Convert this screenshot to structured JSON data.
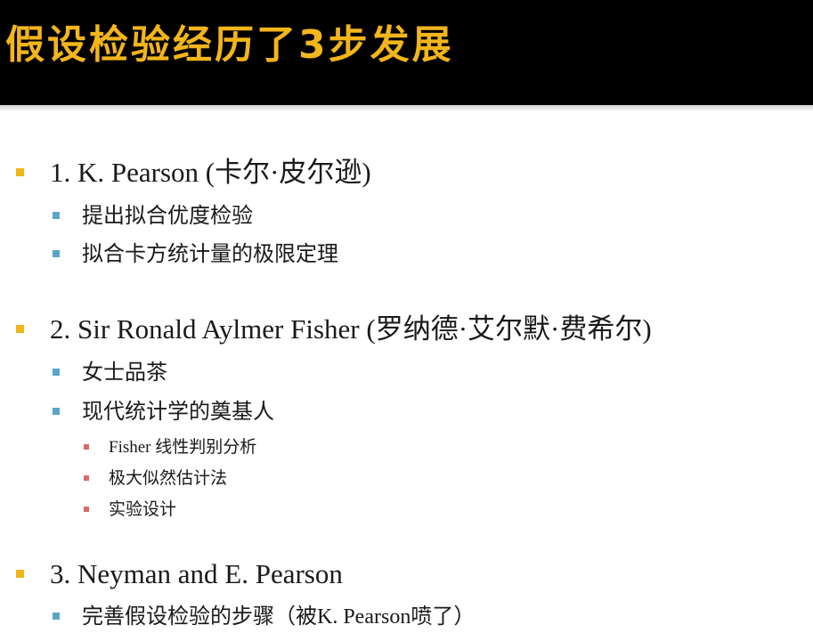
{
  "slide": {
    "title": "假设检验经历了3步发展",
    "colors": {
      "title": "#f2b51a",
      "title_bar": "#000000"
    }
  },
  "outline": [
    {
      "level": 1,
      "bullet_color": "#f2b51a",
      "text": "1. K. Pearson (卡尔·皮尔逊)",
      "children": [
        {
          "level": 2,
          "bullet_color": "#5aa6c8",
          "text": "提出拟合优度检验"
        },
        {
          "level": 2,
          "bullet_color": "#5aa6c8",
          "text": "拟合卡方统计量的极限定理"
        }
      ]
    },
    {
      "level": 1,
      "bullet_color": "#f2b51a",
      "text": "2. Sir Ronald Aylmer Fisher (罗纳德·艾尔默·费希尔)",
      "children": [
        {
          "level": 2,
          "bullet_color": "#5aa6c8",
          "text": "女士品茶"
        },
        {
          "level": 2,
          "bullet_color": "#5aa6c8",
          "text": "现代统计学的奠基人",
          "children": [
            {
              "level": 3,
              "bullet_color": "#d96a6a",
              "text": "Fisher 线性判别分析"
            },
            {
              "level": 3,
              "bullet_color": "#d96a6a",
              "text": "极大似然估计法"
            },
            {
              "level": 3,
              "bullet_color": "#d96a6a",
              "text": "实验设计"
            }
          ]
        }
      ]
    },
    {
      "level": 1,
      "bullet_color": "#f2b51a",
      "text": "3. Neyman and E. Pearson",
      "children": [
        {
          "level": 2,
          "bullet_color": "#5aa6c8",
          "text": "完善假设检验的步骤（被K. Pearson喷了）"
        }
      ]
    }
  ]
}
